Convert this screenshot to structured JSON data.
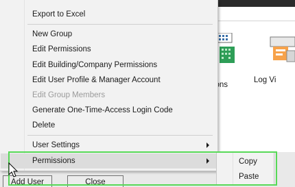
{
  "background": {
    "tools": [
      {
        "label": "cal\nactions",
        "icon": "building-icon"
      },
      {
        "label": "Log Vi",
        "icon": "log-icon"
      }
    ],
    "buttons": {
      "add_user": "Add User",
      "close": "Close"
    }
  },
  "context_menu": {
    "items": [
      {
        "label": "Export to Excel",
        "enabled": true
      },
      {
        "label": "New Group",
        "enabled": true
      },
      {
        "label": "Edit Permissions",
        "enabled": true
      },
      {
        "label": "Edit Building/Company Permissions",
        "enabled": true
      },
      {
        "label": "Edit User Profile & Manager Account",
        "enabled": true
      },
      {
        "label": "Edit Group Members",
        "enabled": false
      },
      {
        "label": "Generate One-Time-Access Login Code",
        "enabled": true
      },
      {
        "label": "Delete",
        "enabled": true
      },
      {
        "label": "User Settings",
        "enabled": true,
        "has_submenu": true
      },
      {
        "label": "Permissions",
        "enabled": true,
        "has_submenu": true,
        "highlighted": true
      }
    ]
  },
  "permissions_submenu": {
    "items": [
      {
        "label": "Copy"
      },
      {
        "label": "Paste"
      }
    ]
  },
  "colors": {
    "annotation_outline": "#57d957",
    "menu_background": "#f2f2f2",
    "highlight": "#dcdcdc",
    "disabled_text": "#9a9a9a"
  }
}
